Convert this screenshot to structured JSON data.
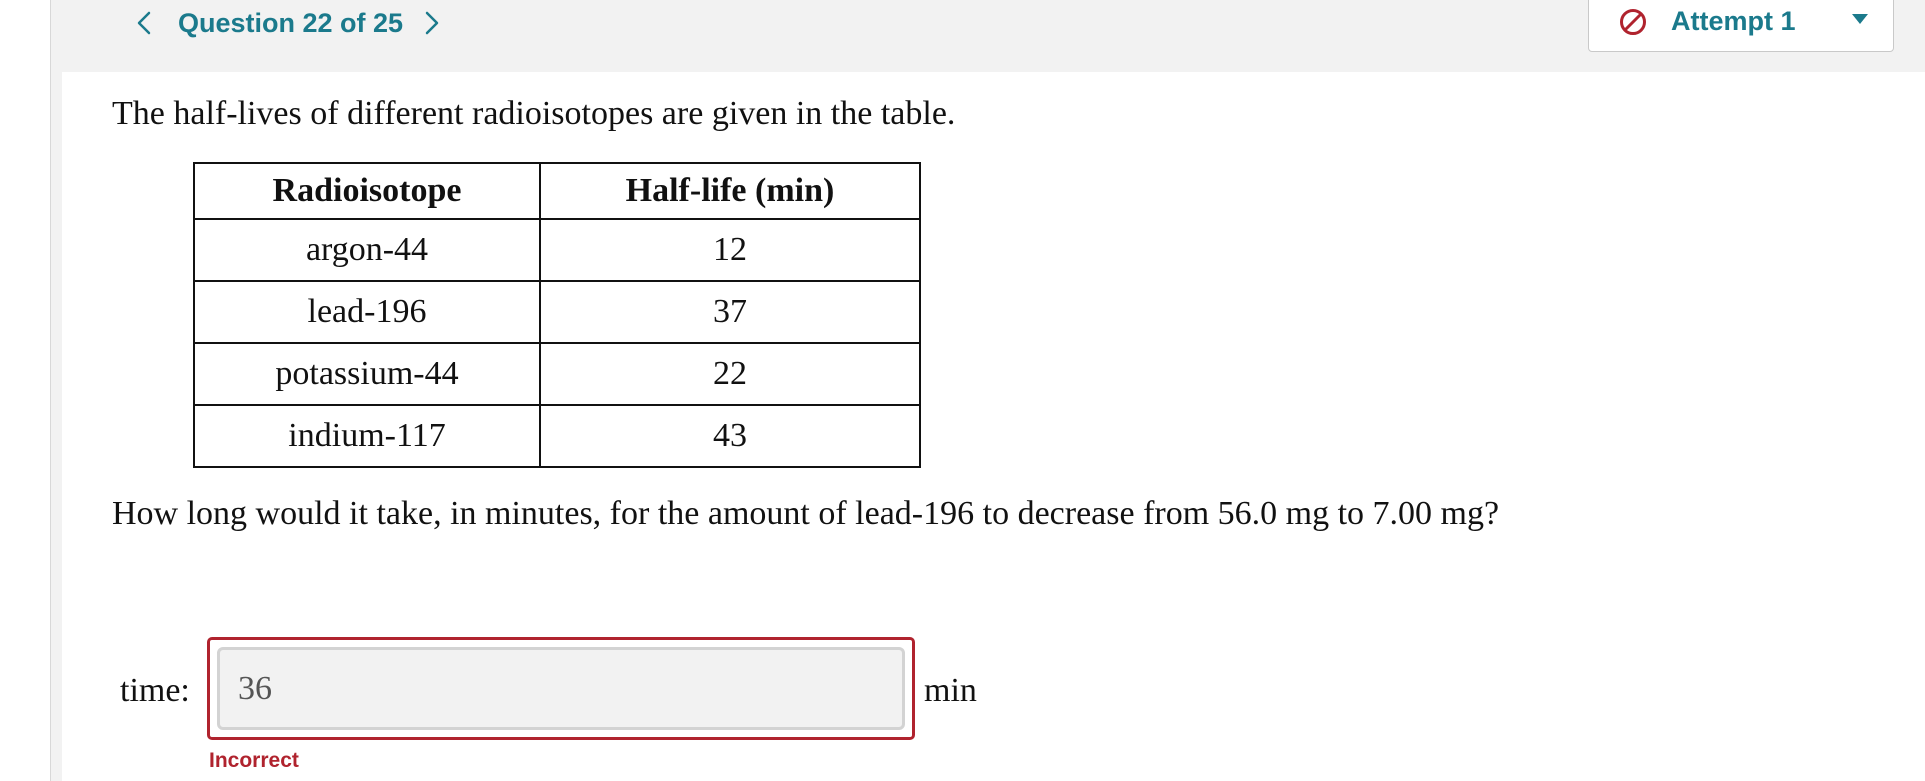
{
  "nav": {
    "question_label": "Question 22 of 25",
    "attempt_label": "Attempt 1"
  },
  "prompt": {
    "intro": "The half-lives of different radioisotopes are given in the table.",
    "question": "How long would it take, in minutes, for the amount of lead-196 to decrease from 56.0 mg to 7.00 mg?"
  },
  "table": {
    "headers": [
      "Radioisotope",
      "Half-life (min)"
    ],
    "rows": [
      [
        "argon-44",
        "12"
      ],
      [
        "lead-196",
        "37"
      ],
      [
        "potassium-44",
        "22"
      ],
      [
        "indium-117",
        "43"
      ]
    ]
  },
  "answer": {
    "label": "time:",
    "value": "36",
    "unit": "min",
    "feedback": "Incorrect"
  },
  "icons": {
    "prev": "chevron-left-icon",
    "next": "chevron-right-icon",
    "attempt_status": "prohibited-circle-icon",
    "dropdown": "caret-down-icon"
  },
  "colors": {
    "accent": "#1b7a8c",
    "error": "#b0232e"
  }
}
